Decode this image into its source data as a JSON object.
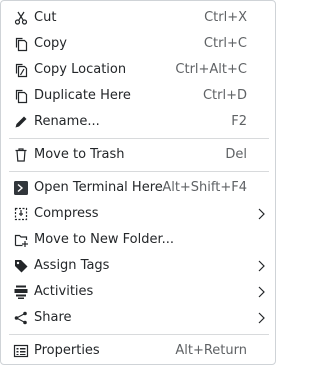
{
  "menu": {
    "items": [
      {
        "label": "Cut",
        "shortcut": "Ctrl+X",
        "icon": "scissors-icon"
      },
      {
        "label": "Copy",
        "shortcut": "Ctrl+C",
        "icon": "copy-icon"
      },
      {
        "label": "Copy Location",
        "shortcut": "Ctrl+Alt+C",
        "icon": "copy-location-icon"
      },
      {
        "label": "Duplicate Here",
        "shortcut": "Ctrl+D",
        "icon": "duplicate-icon"
      },
      {
        "label": "Rename...",
        "shortcut": "F2",
        "icon": "pencil-icon"
      },
      {
        "label": "Move to Trash",
        "shortcut": "Del",
        "icon": "trash-icon"
      },
      {
        "label": "Open Terminal Here",
        "shortcut": "Alt+Shift+F4",
        "icon": "terminal-icon"
      },
      {
        "label": "Compress",
        "shortcut": "",
        "icon": "compress-icon"
      },
      {
        "label": "Move to New Folder...",
        "shortcut": "",
        "icon": "new-folder-icon"
      },
      {
        "label": "Assign Tags",
        "shortcut": "",
        "icon": "tag-icon"
      },
      {
        "label": "Activities",
        "shortcut": "",
        "icon": "activities-icon"
      },
      {
        "label": "Share",
        "shortcut": "",
        "icon": "share-icon"
      },
      {
        "label": "Properties",
        "shortcut": "Alt+Return",
        "icon": "properties-icon"
      }
    ]
  },
  "colors": {
    "text": "#232629",
    "shortcut": "#5f6265",
    "separator": "#d8dadc",
    "border": "#cfd3d7"
  }
}
